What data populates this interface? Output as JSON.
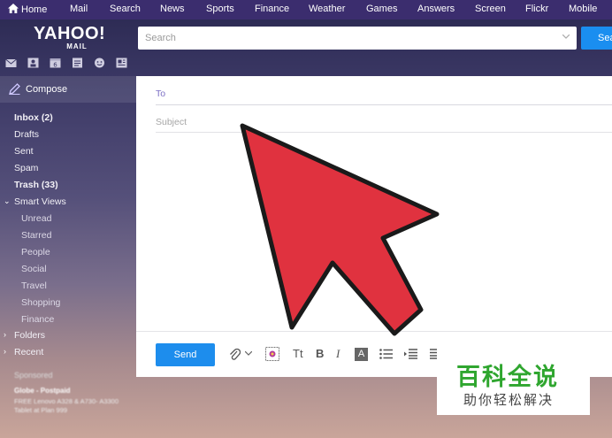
{
  "nav": {
    "home": "Home",
    "items": [
      "Mail",
      "Search",
      "News",
      "Sports",
      "Finance",
      "Weather",
      "Games",
      "Answers",
      "Screen",
      "Flickr",
      "Mobile"
    ]
  },
  "header": {
    "logo_main": "YAHOO!",
    "logo_sub": "MAIL",
    "search_placeholder": "Search",
    "search_button": "Sea"
  },
  "sidebar": {
    "compose": "Compose",
    "folders": {
      "inbox": "Inbox (2)",
      "drafts": "Drafts",
      "sent": "Sent",
      "spam": "Spam",
      "trash": "Trash (33)",
      "smart_views": "Smart Views",
      "unread": "Unread",
      "starred": "Starred",
      "people": "People",
      "social": "Social",
      "travel": "Travel",
      "shopping": "Shopping",
      "finance": "Finance",
      "folders": "Folders",
      "recent": "Recent"
    },
    "sponsored": "Sponsored",
    "ad_title": "Globe - Postpaid",
    "ad_body": "FREE Lenovo A328 & A730- A3300 Tablet at Plan 999"
  },
  "compose": {
    "to_label": "To",
    "subject_label": "Subject",
    "send": "Send",
    "text_size": "Tt",
    "bold": "B",
    "italic": "I",
    "font_color": "A"
  },
  "watermark": {
    "title": "百科全说",
    "subtitle": "助你轻松解决"
  },
  "colors": {
    "nav_bg": "#3b2d6e",
    "accent_blue": "#1d8ded",
    "arrow_red": "#e0323f",
    "watermark_green": "#2fa62f"
  }
}
